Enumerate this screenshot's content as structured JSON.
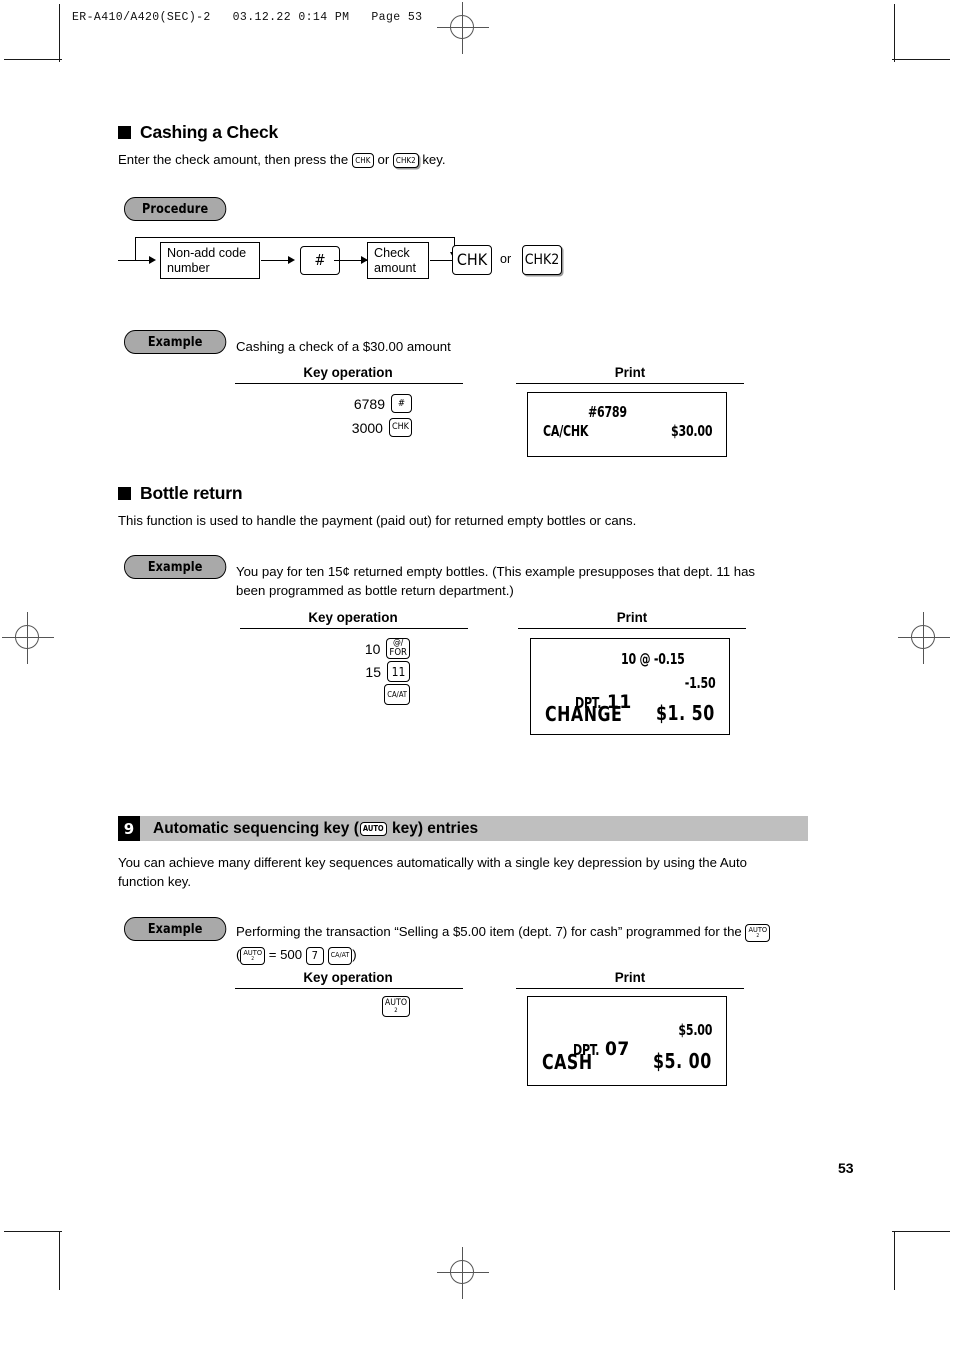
{
  "header": {
    "running_head": "ER-A410/A420(SEC)-2   03.12.22 0:14 PM   Page 53"
  },
  "folio": {
    "page_number": "53"
  },
  "section_check": {
    "heading": "Cashing a Check",
    "intro_before": "Enter the check amount, then press the ",
    "intro_mid": " or ",
    "intro_after": " key.",
    "key_chk": "CHK",
    "key_chk2": "CHK2",
    "procedure_label": "Procedure",
    "flow": {
      "box1_line1": "Non-add code",
      "box1_line2": "number",
      "box2": "#",
      "box3_line1": "Check",
      "box3_line2": "amount",
      "key_end_1": "CHK",
      "or_label": "or",
      "key_end_2": "CHK2"
    },
    "example_label": "Example",
    "example_text": "Cashing a check of a $30.00 amount",
    "col_key_operation": "Key operation",
    "col_print": "Print",
    "key_operations": [
      {
        "number": "6789",
        "key": "#"
      },
      {
        "number": "3000",
        "key": "CHK"
      }
    ],
    "receipt": {
      "code": "#6789",
      "label": "CA/CHK",
      "amount": "$30.00"
    }
  },
  "section_bottle": {
    "heading": "Bottle return",
    "intro": "This function is used to handle the payment (paid out) for returned empty bottles or cans.",
    "example_label": "Example",
    "example_line1": "You pay for ten 15¢ returned empty bottles. (This example presupposes that dept. 11 has",
    "example_line2": "been programmed as bottle return department.)",
    "col_key_operation": "Key operation",
    "col_print": "Print",
    "key_operations": [
      {
        "number": "10",
        "key_top": "@/",
        "key_bottom": "FOR"
      },
      {
        "number": "15",
        "key_top": "11",
        "key_bottom": ""
      },
      {
        "number": "",
        "key_top": "CA/AT",
        "key_bottom": ""
      }
    ],
    "receipt": {
      "qty_line": "10 @ -0.15",
      "dept_label": "DPT.",
      "dept_number": "11",
      "dept_amount": "-1.50",
      "change_label": "CHANGE",
      "change_amount": "$1. 50"
    }
  },
  "section_auto": {
    "number": "9",
    "heading_before": "Automatic sequencing key (",
    "heading_key": "AUTO",
    "heading_after": " key) entries",
    "intro_line1": "You can achieve many different key sequences automatically with a single key depression by using the Auto",
    "intro_line2": "function key.",
    "example_label": "Example",
    "example_line1": "Performing the transaction “Selling a $5.00 item (dept. 7) for cash” programmed for the ",
    "example_line2_open": "(",
    "example_line2_eq": " = 500 ",
    "example_line2_close": ")",
    "key_auto_label": "AUTO",
    "key_auto_sub": "2",
    "key_dept7": "7",
    "key_caat": "CA/AT",
    "col_key_operation": "Key operation",
    "col_print": "Print",
    "receipt": {
      "dept_label": "DPT.",
      "dept_number": "07",
      "dept_amount": "$5.00",
      "cash_label": "CASH",
      "cash_amount": "$5. 00"
    }
  },
  "colors": {
    "band_gray": "#bfbfbf",
    "pill_gray": "#a9a9a9",
    "ink": "#000000"
  }
}
